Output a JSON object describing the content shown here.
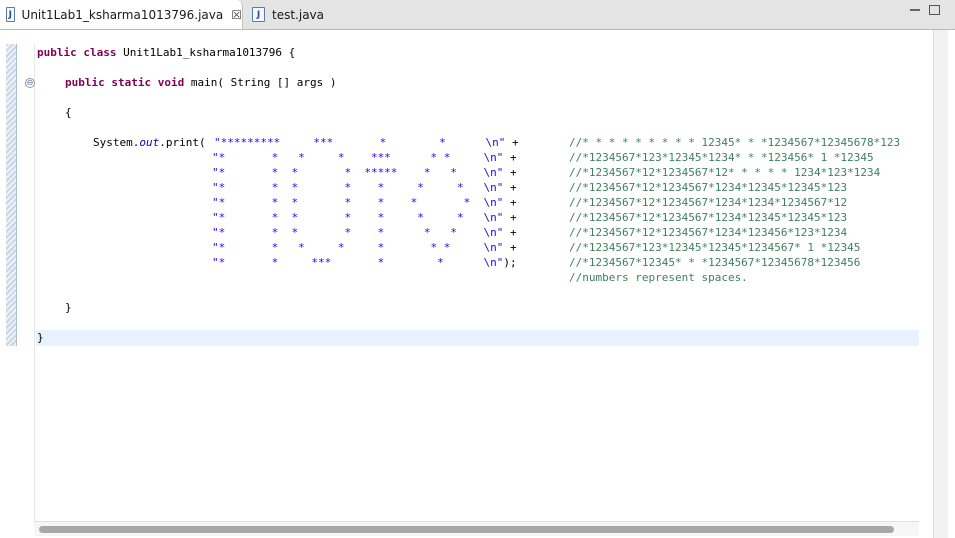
{
  "tabs": [
    {
      "label": "Unit1Lab1_ksharma1013796.java",
      "icon": "java-file-icon",
      "active": true,
      "close": "☒"
    },
    {
      "label": "test.java",
      "icon": "java-file-icon",
      "active": false
    }
  ],
  "icon_letter": "J",
  "fold_glyph": "⊖",
  "code": {
    "class_kw": "public class",
    "class_name": " Unit1Lab1_ksharma1013796 {",
    "method_kw": "public static void",
    "method_sig": " main( String [] args )",
    "open_brace": "{",
    "print_prefix": "System.",
    "print_out": "out",
    "print_call": ".print(",
    "lines": [
      {
        "str": "\"*********     ***       *        *      \\n\"",
        "tail": " +",
        "comment": "//* * * * * * * * * 12345* * *1234567*12345678*123"
      },
      {
        "str": "\"*       *   *     *    ***      * *     \\n\"",
        "tail": " +",
        "comment": "//*1234567*123*12345*1234* * *123456* 1 *12345"
      },
      {
        "str": "\"*       *  *       *  *****    *   *    \\n\"",
        "tail": " +",
        "comment": "//*1234567*12*1234567*12* * * * * 1234*123*1234"
      },
      {
        "str": "\"*       *  *       *    *     *     *   \\n\"",
        "tail": " +",
        "comment": "//*1234567*12*1234567*1234*12345*12345*123"
      },
      {
        "str": "\"*       *  *       *    *    *       *  \\n\"",
        "tail": " +",
        "comment": "//*1234567*12*1234567*1234*1234*1234567*12"
      },
      {
        "str": "\"*       *  *       *    *     *     *   \\n\"",
        "tail": " +",
        "comment": "//*1234567*12*1234567*1234*12345*12345*123"
      },
      {
        "str": "\"*       *  *       *    *      *   *    \\n\"",
        "tail": " +",
        "comment": "//*1234567*12*1234567*1234*123456*123*1234"
      },
      {
        "str": "\"*       *   *     *     *       * *     \\n\"",
        "tail": " +",
        "comment": "//*1234567*123*12345*12345*1234567* 1 *12345"
      },
      {
        "str": "\"*       *     ***       *        *      \\n\"",
        "tail": ");",
        "comment": "//*1234567*12345* * *1234567*12345678*123456"
      }
    ],
    "note": "//numbers represent spaces.",
    "close_inner": "}",
    "close_outer": "}"
  }
}
